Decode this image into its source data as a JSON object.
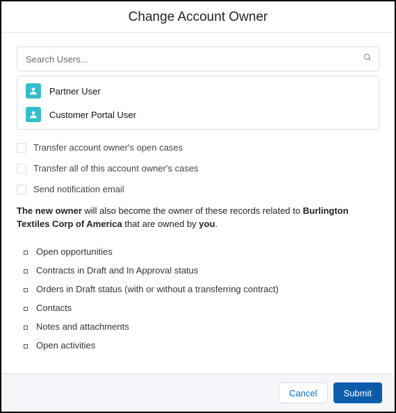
{
  "header": {
    "title": "Change Account Owner"
  },
  "search": {
    "placeholder": "Search Users..."
  },
  "dropdown": {
    "options": [
      {
        "label": "Partner User"
      },
      {
        "label": "Customer Portal User"
      }
    ]
  },
  "checkboxes": [
    {
      "label": "Transfer account owner's open cases"
    },
    {
      "label": "Transfer all of this account owner's cases"
    },
    {
      "label": "Send notification email"
    }
  ],
  "info": {
    "lead": "The new owner",
    "mid1": " will also become the owner of these records related to ",
    "account": "Burlington Textiles Corp of America",
    "mid2": " that are owned by ",
    "who": "you",
    "tail": "."
  },
  "records": [
    "Open opportunities",
    "Contracts in Draft and In Approval status",
    "Orders in Draft status (with or without a transferring contract)",
    "Contacts",
    "Notes and attachments",
    "Open activities"
  ],
  "footer": {
    "cancel": "Cancel",
    "submit": "Submit"
  }
}
